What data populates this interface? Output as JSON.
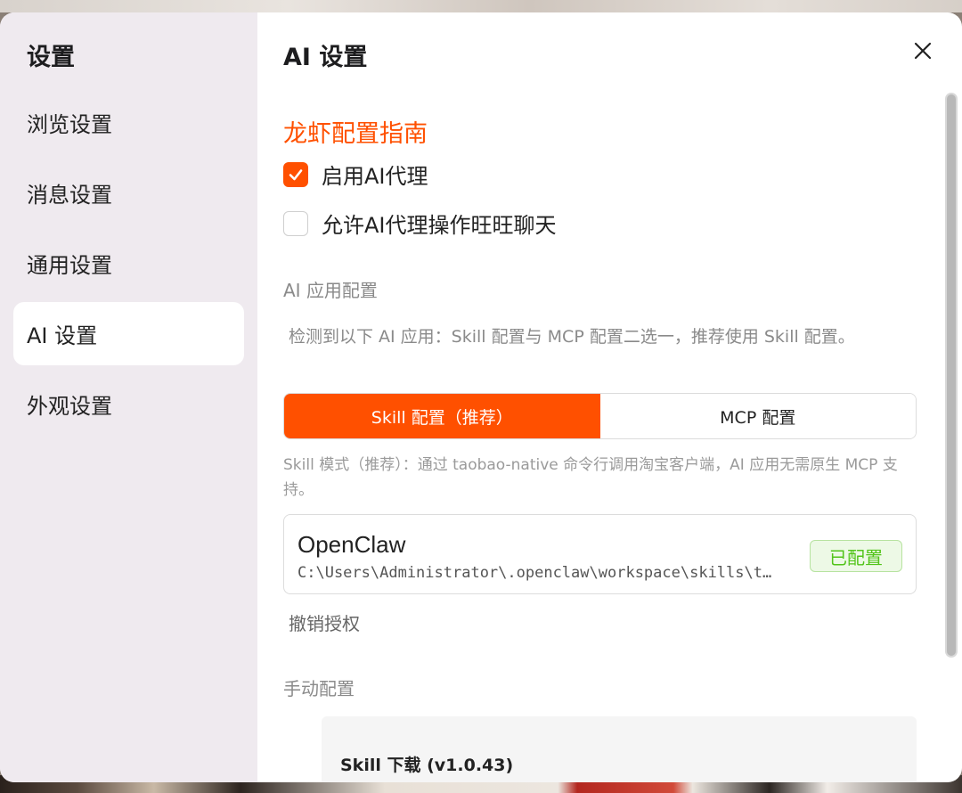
{
  "sidebar": {
    "title": "设置",
    "items": [
      {
        "label": "浏览设置",
        "active": false
      },
      {
        "label": "消息设置",
        "active": false
      },
      {
        "label": "通用设置",
        "active": false
      },
      {
        "label": "AI 设置",
        "active": true
      },
      {
        "label": "外观设置",
        "active": false
      }
    ]
  },
  "main": {
    "title": "AI 设置",
    "close_icon": "close-icon",
    "guide_link": "龙虾配置指南",
    "options": [
      {
        "label": "启用AI代理",
        "checked": true
      },
      {
        "label": "允许AI代理操作旺旺聊天",
        "checked": false
      }
    ],
    "app_config": {
      "section_label": "AI 应用配置",
      "description": "检测到以下 AI 应用：Skill 配置与 MCP 配置二选一，推荐使用 Skill 配置。",
      "tabs": [
        {
          "label": "Skill 配置（推荐）",
          "active": true
        },
        {
          "label": "MCP 配置",
          "active": false
        }
      ],
      "mode_description": "Skill 模式（推荐）：通过 taobao-native 命令行调用淘宝客户端，AI 应用无需原生 MCP 支持。",
      "app": {
        "name": "OpenClaw",
        "path": "C:\\Users\\Administrator\\.openclaw\\workspace\\skills\\t…",
        "status": "已配置"
      },
      "revoke_label": "撤销授权"
    },
    "manual": {
      "section_label": "手动配置",
      "card_title": "Skill 下载 (v1.0.43)"
    }
  },
  "colors": {
    "accent": "#ff5000",
    "sidebar_bg": "#efeaef",
    "badge_green": "#52c41a"
  }
}
